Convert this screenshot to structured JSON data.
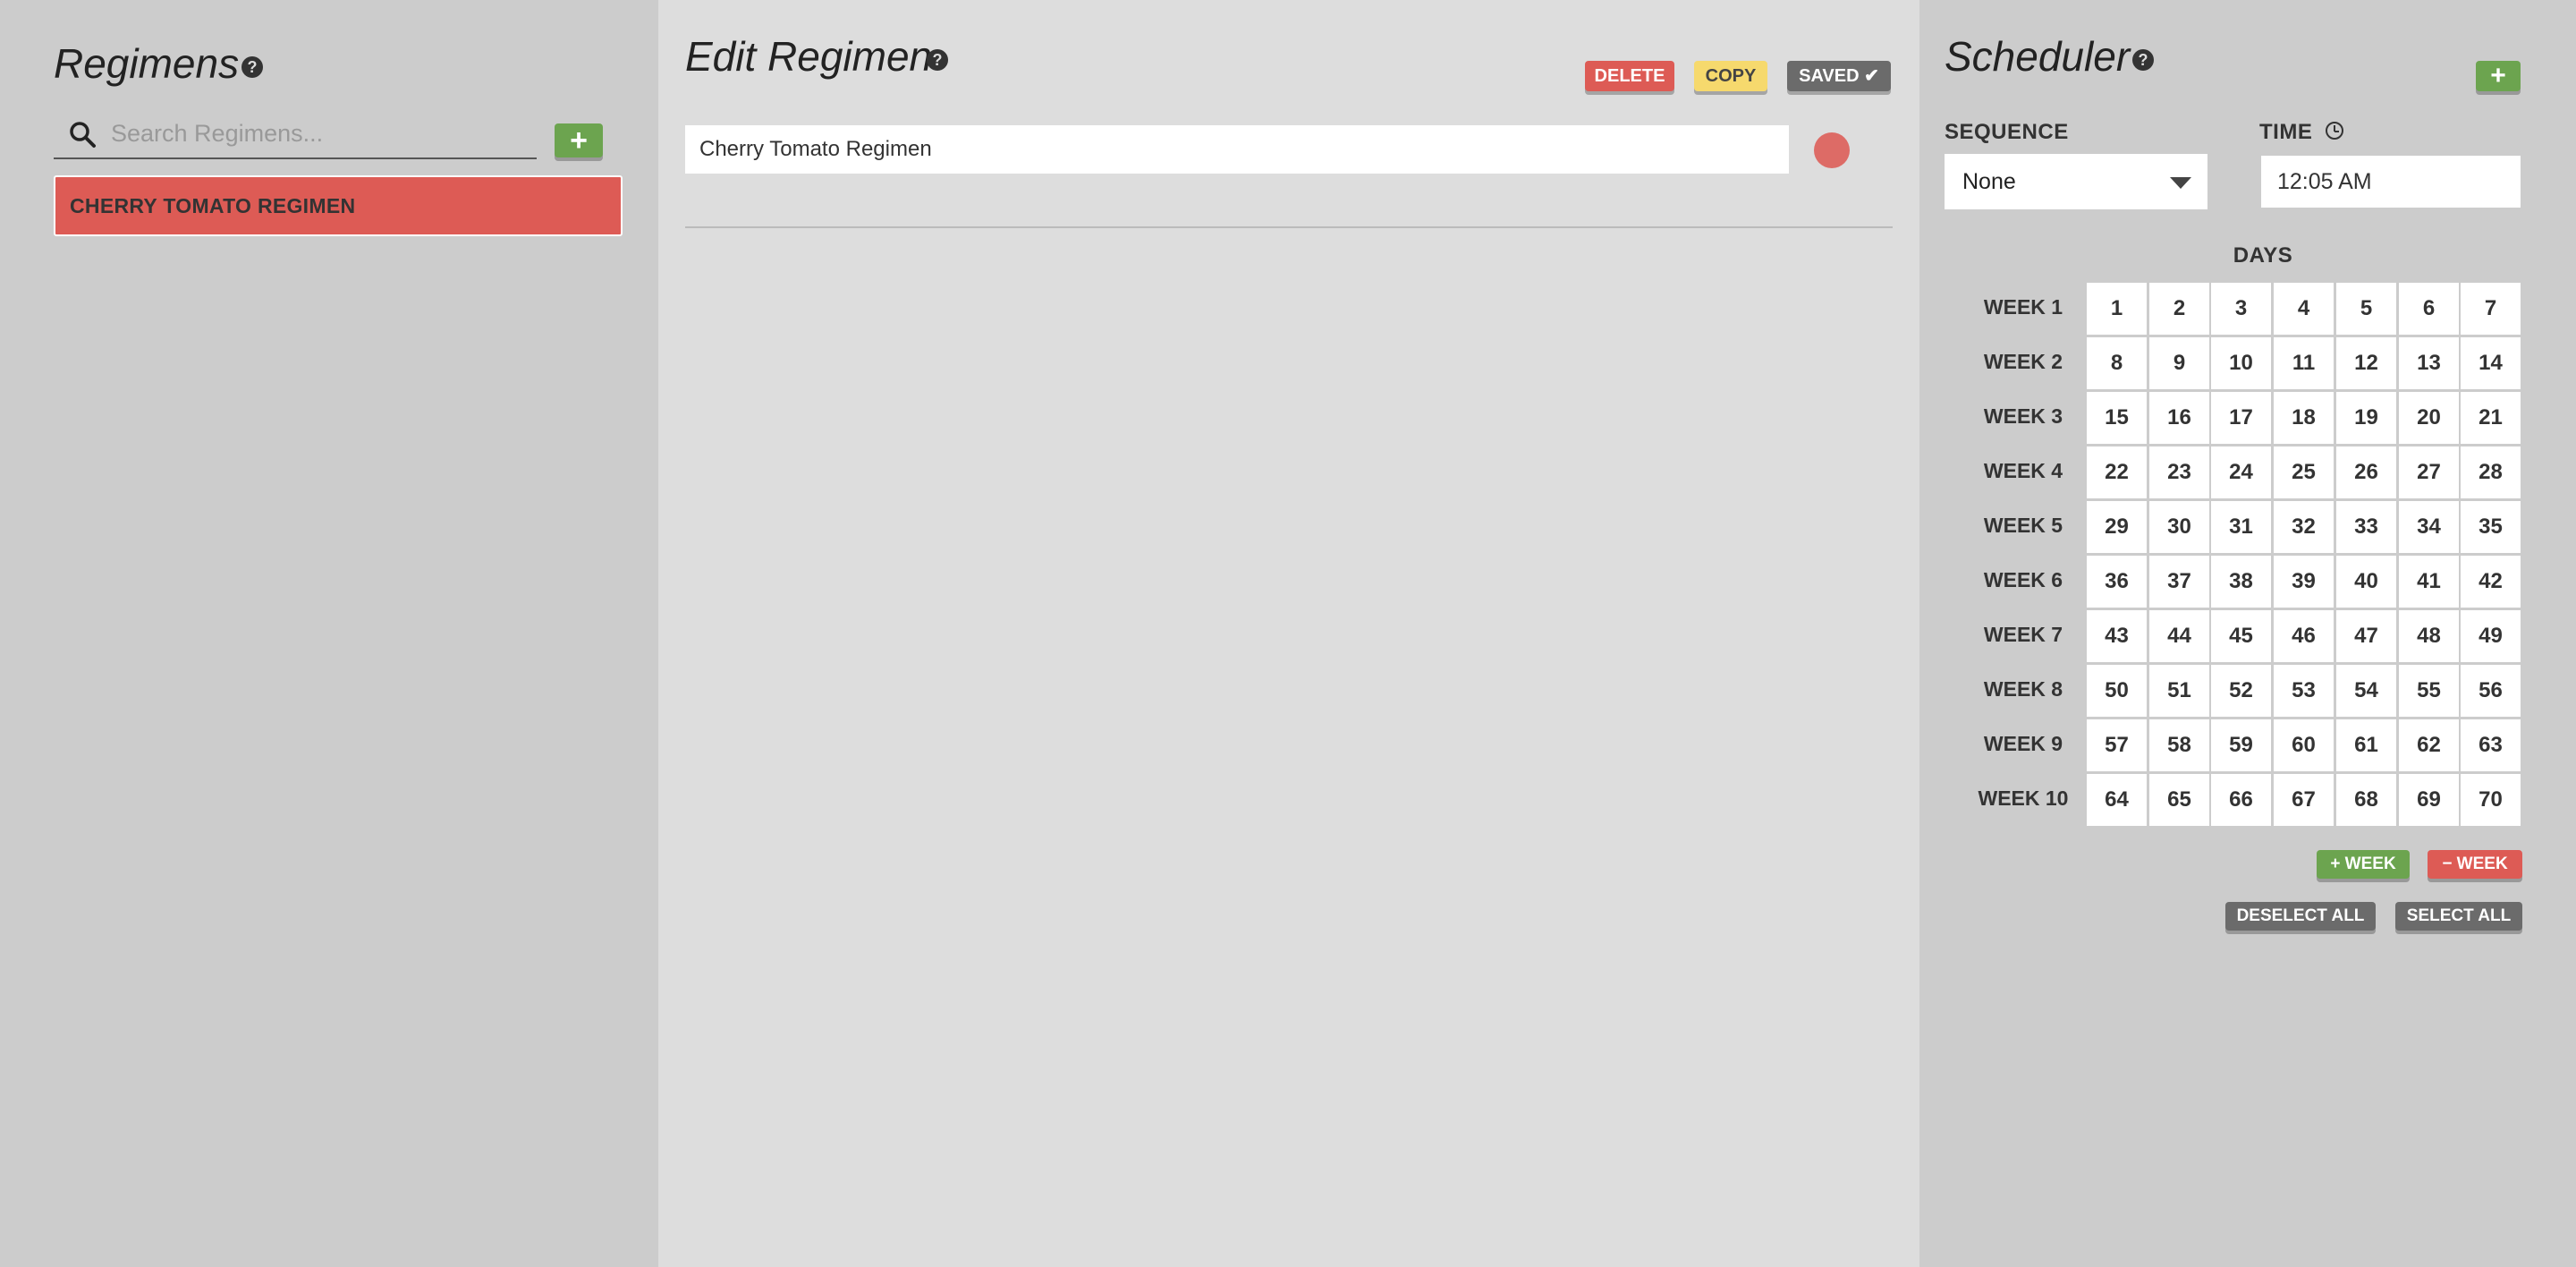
{
  "regimens_panel": {
    "title": "Regimens",
    "search_placeholder": "Search Regimens...",
    "add_label": "+",
    "items": [
      {
        "label": "CHERRY TOMATO REGIMEN"
      }
    ]
  },
  "editor": {
    "title": "Edit Regimen",
    "delete_label": "DELETE",
    "copy_label": "COPY",
    "saved_label": "SAVED ✔",
    "name_value": "Cherry Tomato Regimen",
    "color": "#dd6b66"
  },
  "scheduler": {
    "title": "Scheduler",
    "add_label": "+",
    "sequence_label": "SEQUENCE",
    "sequence_value": "None",
    "time_label": "TIME",
    "time_value": "12:05 AM",
    "days_label": "DAYS",
    "weeks": [
      "WEEK 1",
      "WEEK 2",
      "WEEK 3",
      "WEEK 4",
      "WEEK 5",
      "WEEK 6",
      "WEEK 7",
      "WEEK 8",
      "WEEK 9",
      "WEEK 10"
    ],
    "days": [
      [
        "1",
        "2",
        "3",
        "4",
        "5",
        "6",
        "7"
      ],
      [
        "8",
        "9",
        "10",
        "11",
        "12",
        "13",
        "14"
      ],
      [
        "15",
        "16",
        "17",
        "18",
        "19",
        "20",
        "21"
      ],
      [
        "22",
        "23",
        "24",
        "25",
        "26",
        "27",
        "28"
      ],
      [
        "29",
        "30",
        "31",
        "32",
        "33",
        "34",
        "35"
      ],
      [
        "36",
        "37",
        "38",
        "39",
        "40",
        "41",
        "42"
      ],
      [
        "43",
        "44",
        "45",
        "46",
        "47",
        "48",
        "49"
      ],
      [
        "50",
        "51",
        "52",
        "53",
        "54",
        "55",
        "56"
      ],
      [
        "57",
        "58",
        "59",
        "60",
        "61",
        "62",
        "63"
      ],
      [
        "64",
        "65",
        "66",
        "67",
        "68",
        "69",
        "70"
      ]
    ],
    "add_week_label": "+ WEEK",
    "remove_week_label": "− WEEK",
    "deselect_all_label": "DESELECT ALL",
    "select_all_label": "SELECT ALL"
  },
  "colors": {
    "green": "#6ca44f",
    "red": "#dd5b55",
    "yellow": "#f6d96d",
    "gray": "#6b6b6b"
  }
}
